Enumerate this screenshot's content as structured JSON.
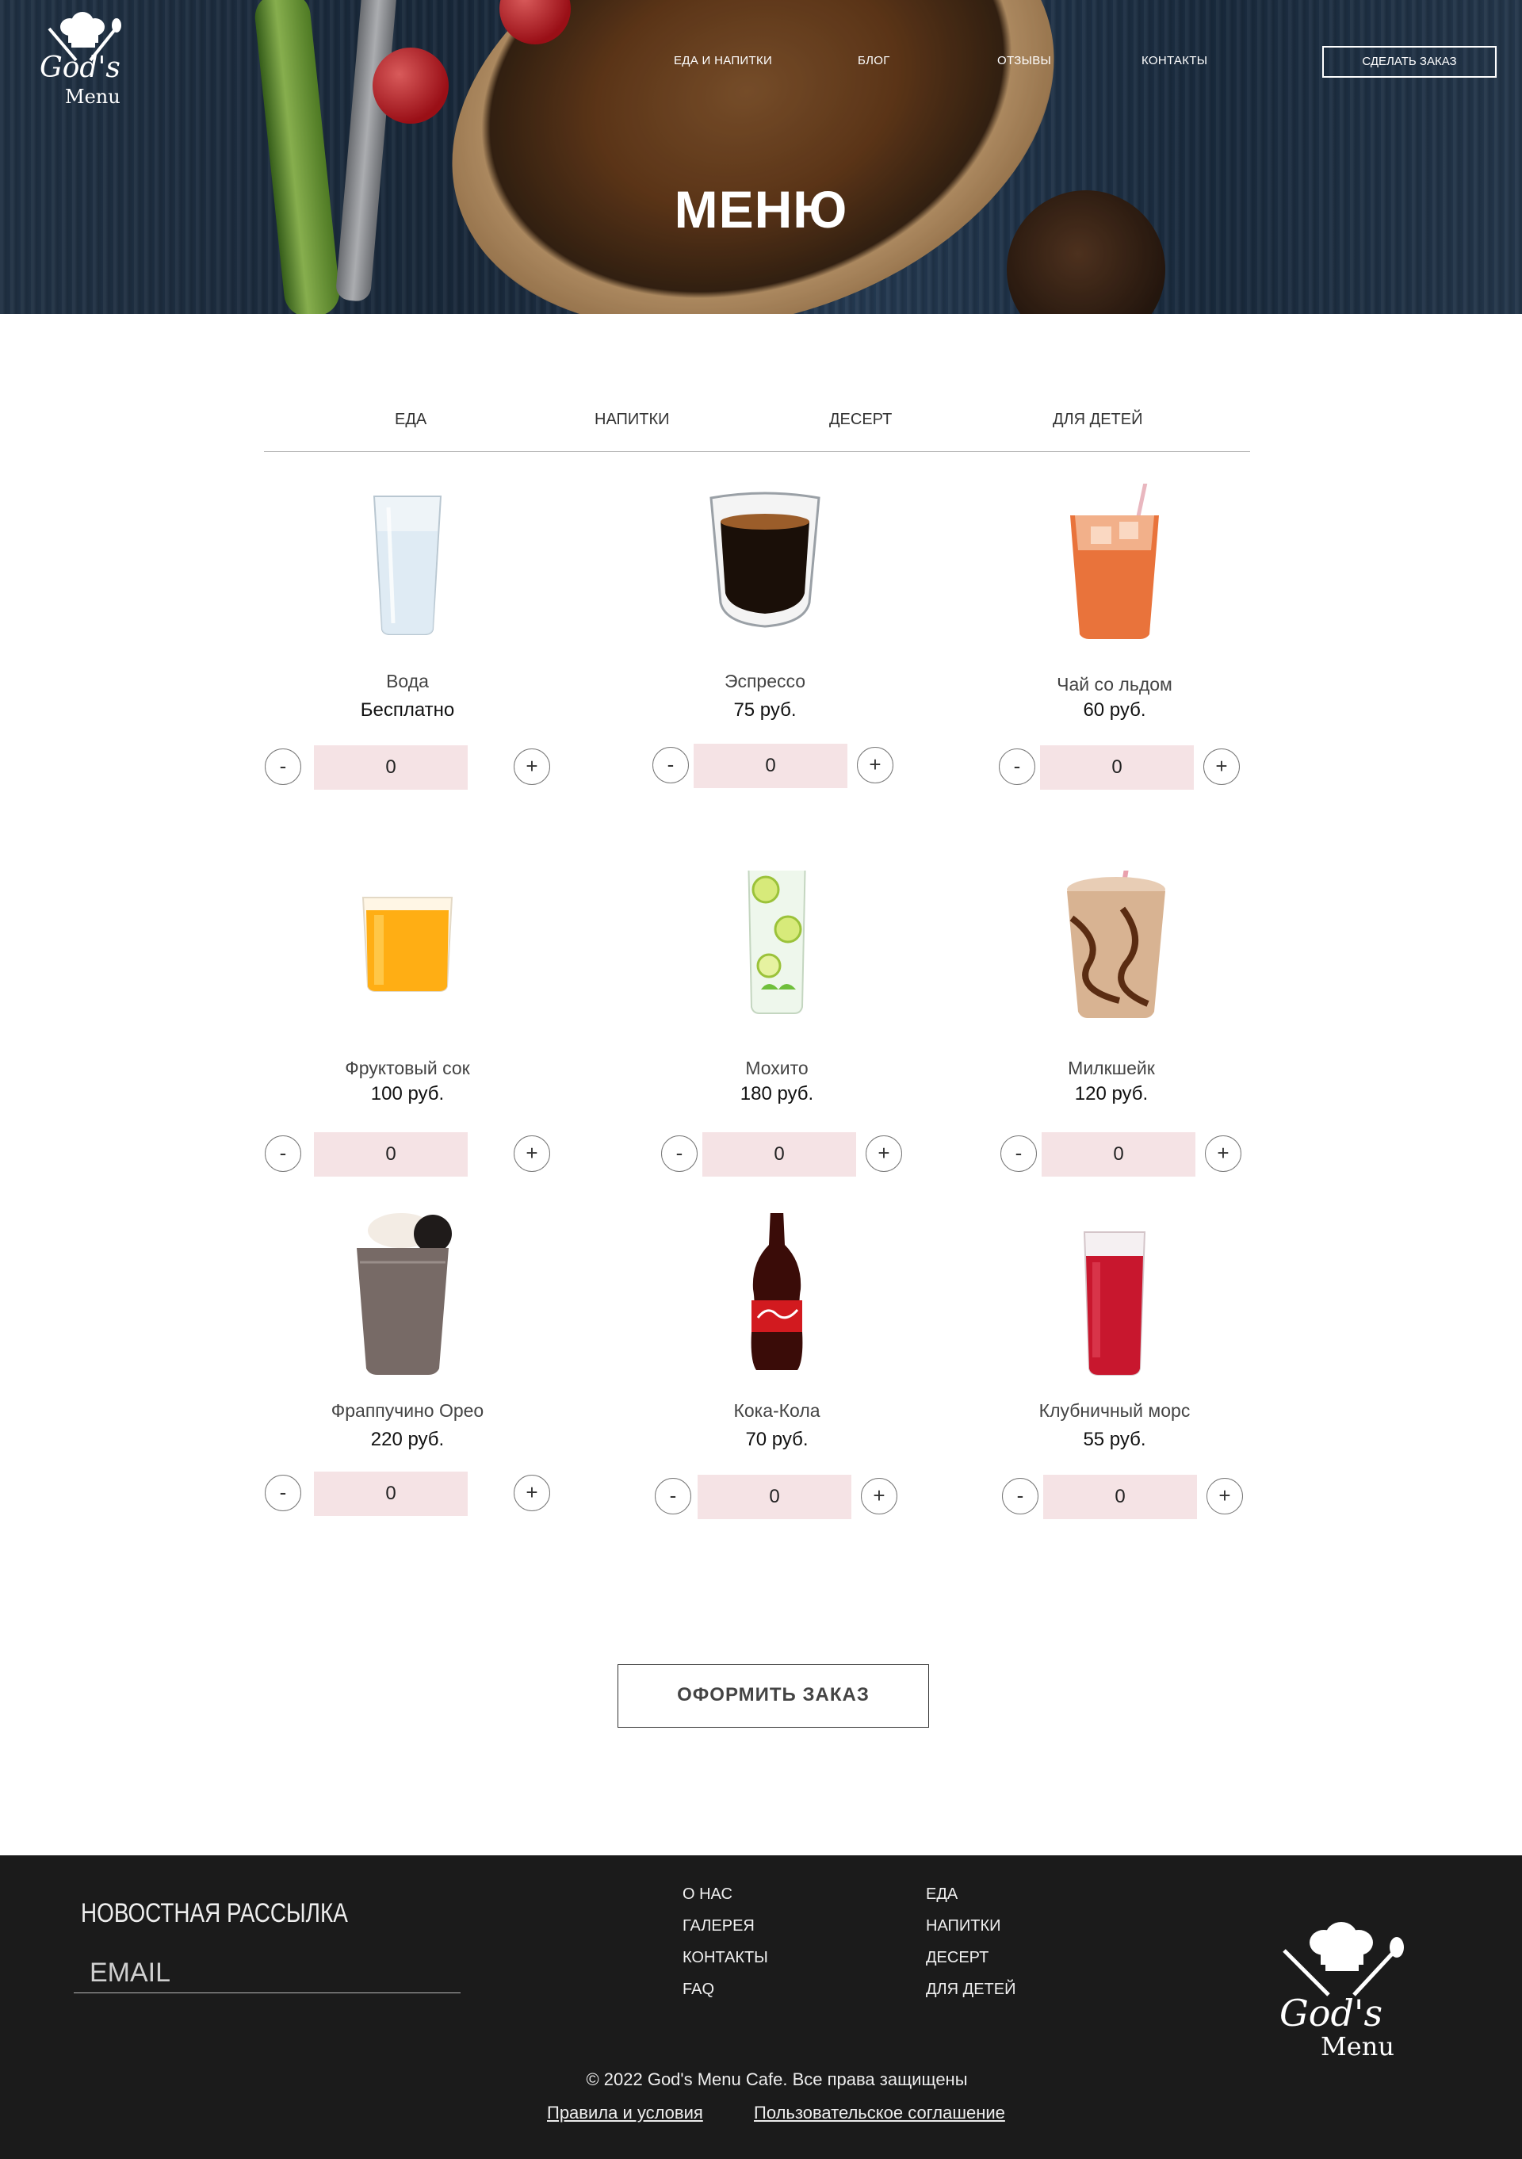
{
  "header": {
    "logo": {
      "line1": "God's",
      "line2": "Menu"
    },
    "nav": [
      "ЕДА И НАПИТКИ",
      "БЛОГ",
      "ОТЗЫВЫ",
      "КОНТАКТЫ"
    ],
    "order_button": "СДЕЛАТЬ ЗАКАЗ",
    "title": "МЕНЮ"
  },
  "tabs": [
    "ЕДА",
    "НАПИТКИ",
    "ДЕСЕРТ",
    "ДЛЯ ДЕТЕЙ"
  ],
  "items": [
    {
      "name": "Вода",
      "price": "Бесплатно",
      "qty": "0",
      "minus": "-",
      "plus": "+",
      "icon": "water-glass"
    },
    {
      "name": "Эспрессо",
      "price": "75 руб.",
      "qty": "0",
      "minus": "-",
      "plus": "+",
      "icon": "espresso-cup"
    },
    {
      "name": "Чай со льдом",
      "price": "60 руб.",
      "qty": "0",
      "minus": "-",
      "plus": "+",
      "icon": "iced-tea"
    },
    {
      "name": "Фруктовый сок",
      "price": "100 руб.",
      "qty": "0",
      "minus": "-",
      "plus": "+",
      "icon": "juice-glass"
    },
    {
      "name": "Мохито",
      "price": "180 руб.",
      "qty": "0",
      "minus": "-",
      "plus": "+",
      "icon": "mojito-glass"
    },
    {
      "name": "Милкшейк",
      "price": "120 руб.",
      "qty": "0",
      "minus": "-",
      "plus": "+",
      "icon": "milkshake-cup"
    },
    {
      "name": "Фраппучино Орео",
      "price": "220 руб.",
      "qty": "0",
      "minus": "-",
      "plus": "+",
      "icon": "frappuccino-cup"
    },
    {
      "name": "Кока-Кола",
      "price": "70 руб.",
      "qty": "0",
      "minus": "-",
      "plus": "+",
      "icon": "cola-bottle"
    },
    {
      "name": "Клубничный морс",
      "price": "55 руб.",
      "qty": "0",
      "minus": "-",
      "plus": "+",
      "icon": "berry-drink-glass"
    }
  ],
  "checkout_button": "ОФОРМИТЬ ЗАКАЗ",
  "footer": {
    "newsletter_title": "НОВОСТНАЯ РАССЫЛКА",
    "email_placeholder": "EMAIL",
    "links_col1": [
      "О НАС",
      "ГАЛЕРЕЯ",
      "КОНТАКТЫ",
      "FAQ"
    ],
    "links_col2": [
      "ЕДА",
      "НАПИТКИ",
      "ДЕСЕРТ",
      "ДЛЯ ДЕТЕЙ"
    ],
    "copyright": "© 2022 God's Menu Cafe. Все права защищены",
    "terms": "Правила и условия",
    "agreement": "Пользовательское соглашение"
  },
  "colors": {
    "qty_bg": "#f5e3e5",
    "footer_bg": "#1b1b1b"
  }
}
